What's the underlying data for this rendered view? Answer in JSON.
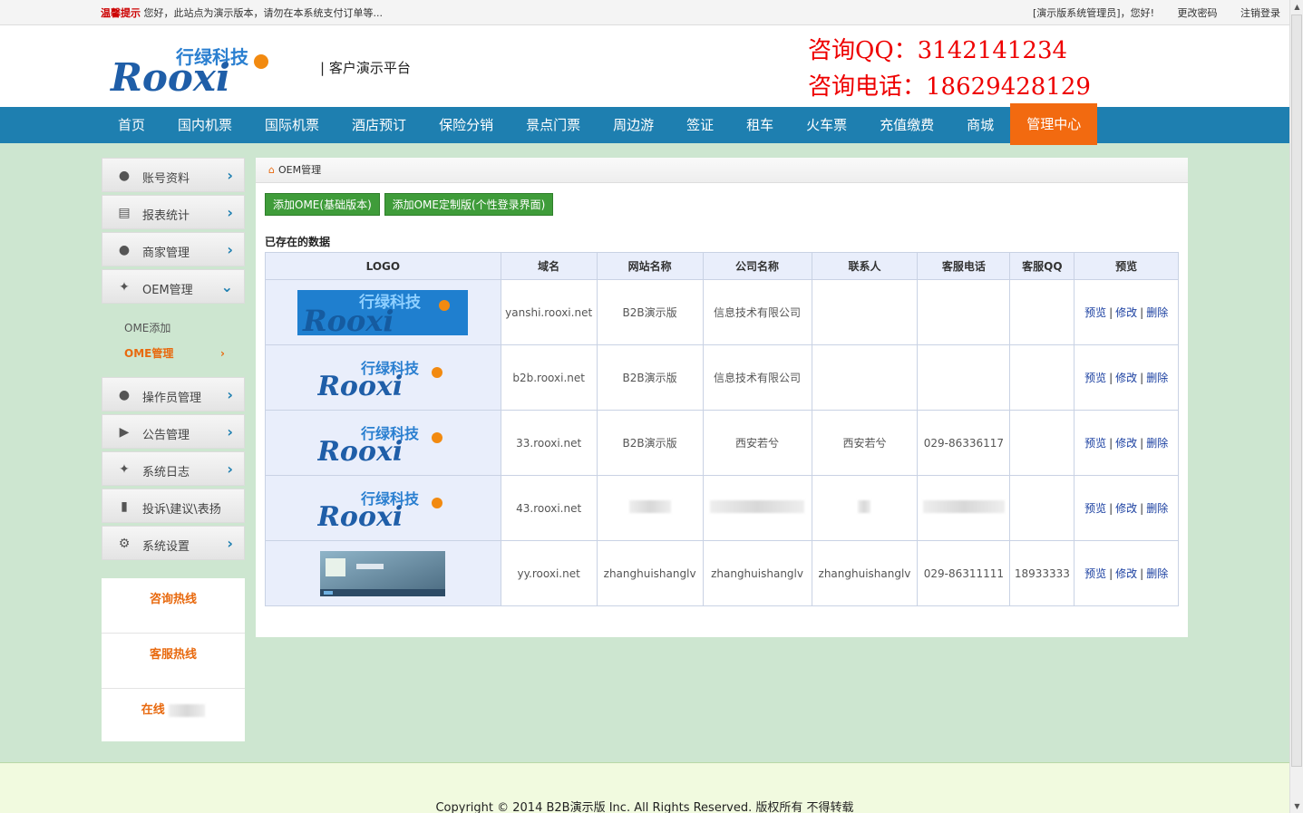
{
  "topbar": {
    "notice_label": "温馨提示",
    "notice_text": "您好，此站点为演示版本，请勿在本系统支付订单等...",
    "user_text": "[演示版系统管理员]，您好!",
    "change_password": "更改密码",
    "logout": "注销登录"
  },
  "header": {
    "platform": "| 客户演示平台",
    "consult_qq": "咨询QQ：3142141234",
    "consult_phone": "咨询电话：18629428129"
  },
  "nav": [
    "首页",
    "国内机票",
    "国际机票",
    "酒店预订",
    "保险分销",
    "景点门票",
    "周边游",
    "签证",
    "租车",
    "火车票",
    "充值缴费",
    "商城",
    "管理中心"
  ],
  "sidebar": {
    "items": [
      {
        "label": "账号资料",
        "icon": "user-icon"
      },
      {
        "label": "报表统计",
        "icon": "report-icon"
      },
      {
        "label": "商家管理",
        "icon": "merchant-icon"
      },
      {
        "label": "OEM管理",
        "icon": "oem-icon"
      }
    ],
    "submenu": [
      "OME添加",
      "OME管理"
    ],
    "items2": [
      {
        "label": "操作员管理",
        "icon": "operator-icon"
      },
      {
        "label": "公告管理",
        "icon": "speaker-icon"
      },
      {
        "label": "系统日志",
        "icon": "log-icon"
      },
      {
        "label": "投诉\\建议\\表扬",
        "icon": "feedback-icon"
      },
      {
        "label": "系统设置",
        "icon": "gear-icon"
      }
    ],
    "hotlines": [
      "咨询热线",
      "客服热线",
      "在线"
    ]
  },
  "main": {
    "breadcrumb": "OEM管理",
    "btn_add_basic": "添加OME(基础版本)",
    "btn_add_custom": "添加OME定制版(个性登录界面)",
    "existing_label": "已存在的数据",
    "columns": [
      "LOGO",
      "域名",
      "网站名称",
      "公司名称",
      "联系人",
      "客服电话",
      "客服QQ",
      "预览"
    ],
    "rows": [
      {
        "domain": "yanshi.rooxi.net",
        "site": "B2B演示版",
        "company": "信息技术有限公司",
        "contact": "",
        "phone": "",
        "qq": ""
      },
      {
        "domain": "b2b.rooxi.net",
        "site": "B2B演示版",
        "company": "信息技术有限公司",
        "contact": "",
        "phone": "",
        "qq": ""
      },
      {
        "domain": "33.rooxi.net",
        "site": "B2B演示版",
        "company": "西安若兮",
        "contact": "西安若兮",
        "phone": "029-86336117",
        "qq": ""
      },
      {
        "domain": "43.rooxi.net",
        "site": "",
        "company": "",
        "contact": "",
        "phone": "",
        "qq": ""
      },
      {
        "domain": "yy.rooxi.net",
        "site": "zhanghuishanglv",
        "company": "zhanghuishanglv",
        "contact": "zhanghuishanglv",
        "phone": "029-86311111",
        "qq": "18933333"
      }
    ],
    "ops": [
      "预览",
      "修改",
      "删除"
    ]
  },
  "logo_text": {
    "cn": "行绿科技",
    "en": "Rooxi"
  },
  "footer": {
    "copyright": "Copyright © 2014 B2B演示版 Inc. All Rights Reserved. 版权所有 不得转载"
  },
  "colors": {
    "nav": "#1e7fb0",
    "active": "#f26a10",
    "accent": "#e8690e",
    "button": "#3f9c3a"
  }
}
